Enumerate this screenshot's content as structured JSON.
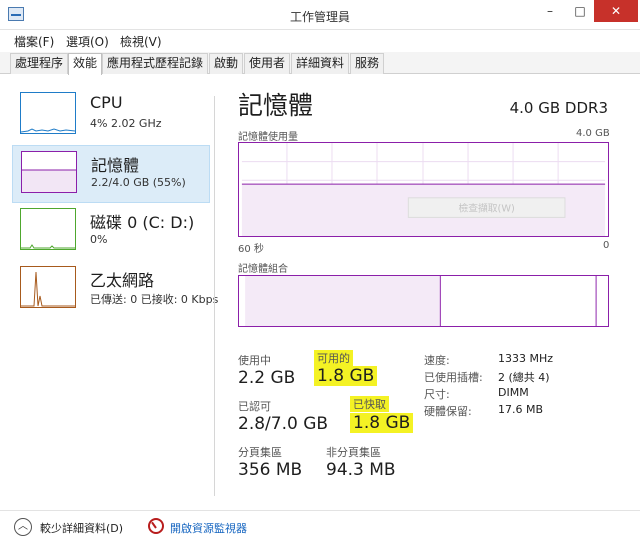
{
  "window": {
    "title": "工作管理員",
    "minimize": "–",
    "maximize": "□",
    "close": "✕"
  },
  "menu": [
    "檔案(F)",
    "選項(O)",
    "檢視(V)"
  ],
  "tabs": [
    "處理程序",
    "效能",
    "應用程式歷程記錄",
    "啟動",
    "使用者",
    "詳細資料",
    "服務"
  ],
  "sidebar": {
    "cpu": {
      "name": "CPU",
      "sub": "4% 2.02 GHz",
      "color": "#1f7cc8"
    },
    "memory": {
      "name": "記憶體",
      "sub": "2.2/4.0 GB (55%)",
      "color": "#8b1fa9"
    },
    "disk": {
      "name": "磁碟 0 (C: D:)",
      "sub": "0%",
      "color": "#4ea72e"
    },
    "ethernet": {
      "name": "乙太網路",
      "sub": "已傳送: 0 已接收: 0 Kbps",
      "color": "#a75a1d"
    }
  },
  "main": {
    "title": "記憶體",
    "spec": "4.0 GB DDR3",
    "usage_label": "記憶體使用量",
    "usage_max": "4.0 GB",
    "time_label": "60 秒",
    "time_zero": "0",
    "composition_label": "記憶體組合",
    "hidden_button": "檢查擷取(W)"
  },
  "stats": {
    "in_use_label": "使用中",
    "in_use": "2.2 GB",
    "available_label": "可用的",
    "available": "1.8 GB",
    "committed_label": "已認可",
    "committed": "2.8/7.0 GB",
    "cached_label": "已快取",
    "cached": "1.8 GB",
    "paged_label": "分頁集區",
    "paged": "356 MB",
    "nonpaged_label": "非分頁集區",
    "nonpaged": "94.3 MB"
  },
  "details": [
    {
      "label": "速度:",
      "value": "1333 MHz"
    },
    {
      "label": "已使用插槽:",
      "value": "2 (總共 4)"
    },
    {
      "label": "尺寸:",
      "value": "DIMM"
    },
    {
      "label": "硬體保留:",
      "value": "17.6 MB"
    }
  ],
  "footer": {
    "fewer": "較少詳細資料(D)",
    "resource_monitor": "開啟資源監視器"
  }
}
